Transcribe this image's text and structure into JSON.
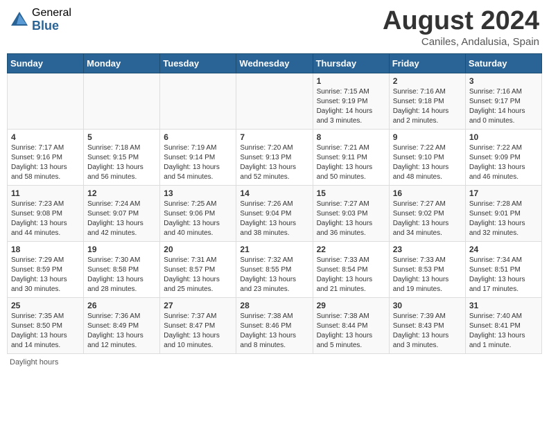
{
  "header": {
    "logo_general": "General",
    "logo_blue": "Blue",
    "month_title": "August 2024",
    "location": "Caniles, Andalusia, Spain"
  },
  "weekdays": [
    "Sunday",
    "Monday",
    "Tuesday",
    "Wednesday",
    "Thursday",
    "Friday",
    "Saturday"
  ],
  "footer": {
    "note": "Daylight hours"
  },
  "weeks": [
    {
      "days": [
        {
          "num": "",
          "info": ""
        },
        {
          "num": "",
          "info": ""
        },
        {
          "num": "",
          "info": ""
        },
        {
          "num": "",
          "info": ""
        },
        {
          "num": "1",
          "info": "Sunrise: 7:15 AM\nSunset: 9:19 PM\nDaylight: 14 hours\nand 3 minutes."
        },
        {
          "num": "2",
          "info": "Sunrise: 7:16 AM\nSunset: 9:18 PM\nDaylight: 14 hours\nand 2 minutes."
        },
        {
          "num": "3",
          "info": "Sunrise: 7:16 AM\nSunset: 9:17 PM\nDaylight: 14 hours\nand 0 minutes."
        }
      ]
    },
    {
      "days": [
        {
          "num": "4",
          "info": "Sunrise: 7:17 AM\nSunset: 9:16 PM\nDaylight: 13 hours\nand 58 minutes."
        },
        {
          "num": "5",
          "info": "Sunrise: 7:18 AM\nSunset: 9:15 PM\nDaylight: 13 hours\nand 56 minutes."
        },
        {
          "num": "6",
          "info": "Sunrise: 7:19 AM\nSunset: 9:14 PM\nDaylight: 13 hours\nand 54 minutes."
        },
        {
          "num": "7",
          "info": "Sunrise: 7:20 AM\nSunset: 9:13 PM\nDaylight: 13 hours\nand 52 minutes."
        },
        {
          "num": "8",
          "info": "Sunrise: 7:21 AM\nSunset: 9:11 PM\nDaylight: 13 hours\nand 50 minutes."
        },
        {
          "num": "9",
          "info": "Sunrise: 7:22 AM\nSunset: 9:10 PM\nDaylight: 13 hours\nand 48 minutes."
        },
        {
          "num": "10",
          "info": "Sunrise: 7:22 AM\nSunset: 9:09 PM\nDaylight: 13 hours\nand 46 minutes."
        }
      ]
    },
    {
      "days": [
        {
          "num": "11",
          "info": "Sunrise: 7:23 AM\nSunset: 9:08 PM\nDaylight: 13 hours\nand 44 minutes."
        },
        {
          "num": "12",
          "info": "Sunrise: 7:24 AM\nSunset: 9:07 PM\nDaylight: 13 hours\nand 42 minutes."
        },
        {
          "num": "13",
          "info": "Sunrise: 7:25 AM\nSunset: 9:06 PM\nDaylight: 13 hours\nand 40 minutes."
        },
        {
          "num": "14",
          "info": "Sunrise: 7:26 AM\nSunset: 9:04 PM\nDaylight: 13 hours\nand 38 minutes."
        },
        {
          "num": "15",
          "info": "Sunrise: 7:27 AM\nSunset: 9:03 PM\nDaylight: 13 hours\nand 36 minutes."
        },
        {
          "num": "16",
          "info": "Sunrise: 7:27 AM\nSunset: 9:02 PM\nDaylight: 13 hours\nand 34 minutes."
        },
        {
          "num": "17",
          "info": "Sunrise: 7:28 AM\nSunset: 9:01 PM\nDaylight: 13 hours\nand 32 minutes."
        }
      ]
    },
    {
      "days": [
        {
          "num": "18",
          "info": "Sunrise: 7:29 AM\nSunset: 8:59 PM\nDaylight: 13 hours\nand 30 minutes."
        },
        {
          "num": "19",
          "info": "Sunrise: 7:30 AM\nSunset: 8:58 PM\nDaylight: 13 hours\nand 28 minutes."
        },
        {
          "num": "20",
          "info": "Sunrise: 7:31 AM\nSunset: 8:57 PM\nDaylight: 13 hours\nand 25 minutes."
        },
        {
          "num": "21",
          "info": "Sunrise: 7:32 AM\nSunset: 8:55 PM\nDaylight: 13 hours\nand 23 minutes."
        },
        {
          "num": "22",
          "info": "Sunrise: 7:33 AM\nSunset: 8:54 PM\nDaylight: 13 hours\nand 21 minutes."
        },
        {
          "num": "23",
          "info": "Sunrise: 7:33 AM\nSunset: 8:53 PM\nDaylight: 13 hours\nand 19 minutes."
        },
        {
          "num": "24",
          "info": "Sunrise: 7:34 AM\nSunset: 8:51 PM\nDaylight: 13 hours\nand 17 minutes."
        }
      ]
    },
    {
      "days": [
        {
          "num": "25",
          "info": "Sunrise: 7:35 AM\nSunset: 8:50 PM\nDaylight: 13 hours\nand 14 minutes."
        },
        {
          "num": "26",
          "info": "Sunrise: 7:36 AM\nSunset: 8:49 PM\nDaylight: 13 hours\nand 12 minutes."
        },
        {
          "num": "27",
          "info": "Sunrise: 7:37 AM\nSunset: 8:47 PM\nDaylight: 13 hours\nand 10 minutes."
        },
        {
          "num": "28",
          "info": "Sunrise: 7:38 AM\nSunset: 8:46 PM\nDaylight: 13 hours\nand 8 minutes."
        },
        {
          "num": "29",
          "info": "Sunrise: 7:38 AM\nSunset: 8:44 PM\nDaylight: 13 hours\nand 5 minutes."
        },
        {
          "num": "30",
          "info": "Sunrise: 7:39 AM\nSunset: 8:43 PM\nDaylight: 13 hours\nand 3 minutes."
        },
        {
          "num": "31",
          "info": "Sunrise: 7:40 AM\nSunset: 8:41 PM\nDaylight: 13 hours\nand 1 minute."
        }
      ]
    }
  ]
}
